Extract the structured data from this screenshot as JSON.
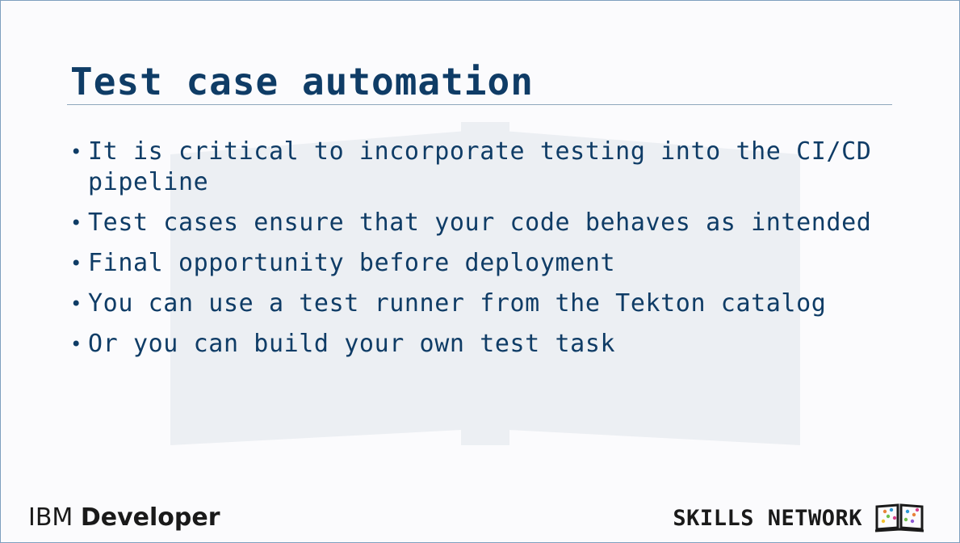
{
  "slide": {
    "title": "Test case automation",
    "bullets": [
      {
        "text": "It is critical to incorporate testing into the CI/CD pipeline"
      },
      {
        "text": "Test cases ensure that your code behaves as intended"
      },
      {
        "text": "Final opportunity before deployment"
      },
      {
        "text": "You can use a test runner from the Tekton catalog"
      },
      {
        "text": "Or you can build your own test task"
      }
    ],
    "bullet_symbol": "•"
  },
  "footer": {
    "left_brand_1": "IBM",
    "left_brand_2": "Developer",
    "right_brand": "SKILLS NETWORK",
    "right_logo_icon": "skills-network-book-logo"
  },
  "colors": {
    "text_primary": "#0f3c66",
    "rule": "#8fa7bd",
    "footer_text": "#1a1a1a"
  }
}
